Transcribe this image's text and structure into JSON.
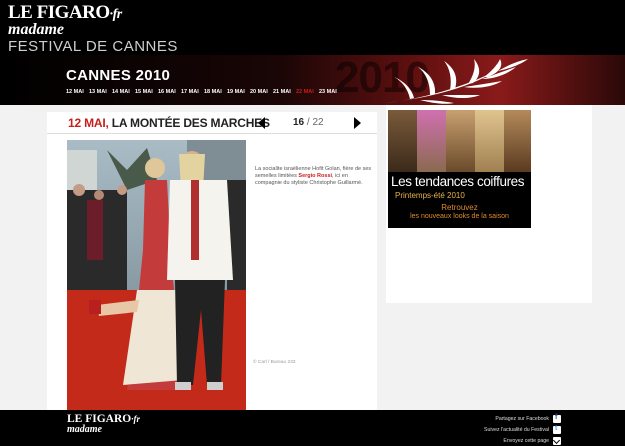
{
  "header": {
    "logo_brand": "LE FIGARO",
    "logo_suffix": "·fr",
    "logo_sub": "madame",
    "section_title": "FESTIVAL DE CANNES"
  },
  "festival_nav": {
    "title": "CANNES 2010",
    "year_watermark": "2010",
    "dates": [
      {
        "label": "12 MAI",
        "active": false
      },
      {
        "label": "13 MAI",
        "active": false
      },
      {
        "label": "14 MAI",
        "active": false
      },
      {
        "label": "15 MAI",
        "active": false
      },
      {
        "label": "16 MAI",
        "active": false
      },
      {
        "label": "17 MAI",
        "active": false
      },
      {
        "label": "18 MAI",
        "active": false
      },
      {
        "label": "19 MAI",
        "active": false
      },
      {
        "label": "20 MAI",
        "active": false
      },
      {
        "label": "21 MAI",
        "active": false
      },
      {
        "label": "22 MAI",
        "active": true
      },
      {
        "label": "23 MAI",
        "active": false
      }
    ]
  },
  "gallery": {
    "date": "12 MAI,",
    "title": "LA MONTÉE DES MARCHES",
    "current": "16",
    "separator": " / ",
    "total": "22",
    "caption_before": "La socialite israélienne Hofit Golan, fière de ses semelles limitées ",
    "caption_highlight": "Sergio Rossi",
    "caption_after": ", ici en compagnie du styliste Christophe Guillarmé.",
    "credit": "© Carl / Bureau 233"
  },
  "ad": {
    "headline": "Les tendances coiffures",
    "subheadline": "Printemps-été 2010",
    "cta_line1": "Retrouvez",
    "cta_line2": "les nouveaux looks de la saison"
  },
  "footer": {
    "logo_brand": "LE FIGARO",
    "logo_suffix": "·fr",
    "logo_sub": "madame",
    "share_facebook": "Partagez sur Facebook",
    "share_twitter": "Suivez l'actualité du Festival",
    "share_email": "Envoyez cette page"
  },
  "colors": {
    "accent_red": "#c81e1e",
    "ad_gold": "#e8b34a"
  }
}
